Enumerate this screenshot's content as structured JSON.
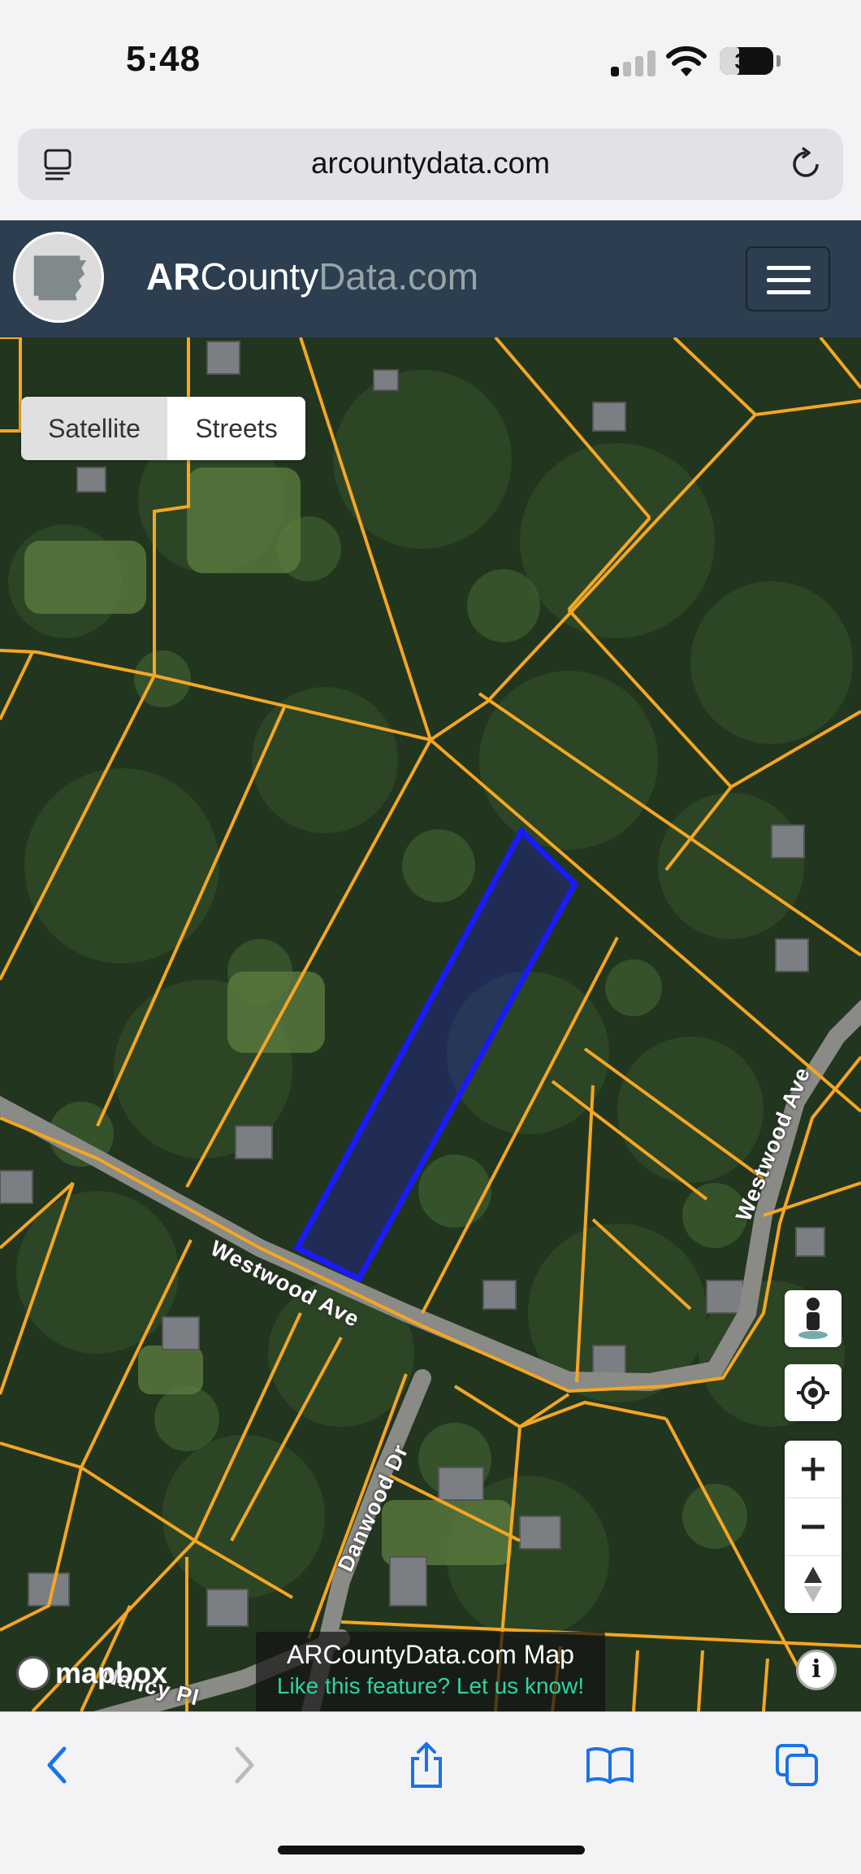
{
  "status_bar": {
    "time": "5:48",
    "battery": "37",
    "battery_level_pct": 37
  },
  "browser": {
    "url": "arcountydata.com"
  },
  "site": {
    "brand_part1": "AR",
    "brand_part2": "County",
    "brand_part3": "Data",
    "brand_part4": ".com"
  },
  "map": {
    "toggle": {
      "satellite": "Satellite",
      "streets": "Streets"
    },
    "road_labels": {
      "westwood_main": "Westwood Ave",
      "westwood_curve": "Westwood Ave",
      "danwood": "Danwood Dr",
      "nancy": "Nancy Pl"
    },
    "attribution": {
      "title": "ARCountyData.com Map",
      "link": "Like this feature? Let us know!",
      "mapbox": "mapbox"
    },
    "colors": {
      "parcel_lines": "#f5a623",
      "selected_parcel": "#1a1aff",
      "header_bg": "#2c3e50"
    }
  },
  "icons": [
    "tabs-icon",
    "reload-icon",
    "menu-icon",
    "streetview-icon",
    "locate-icon",
    "zoom-in-icon",
    "zoom-out-icon",
    "compass-icon",
    "info-icon",
    "back-icon",
    "forward-icon",
    "share-icon",
    "bookmarks-icon",
    "tabs-overview-icon"
  ]
}
